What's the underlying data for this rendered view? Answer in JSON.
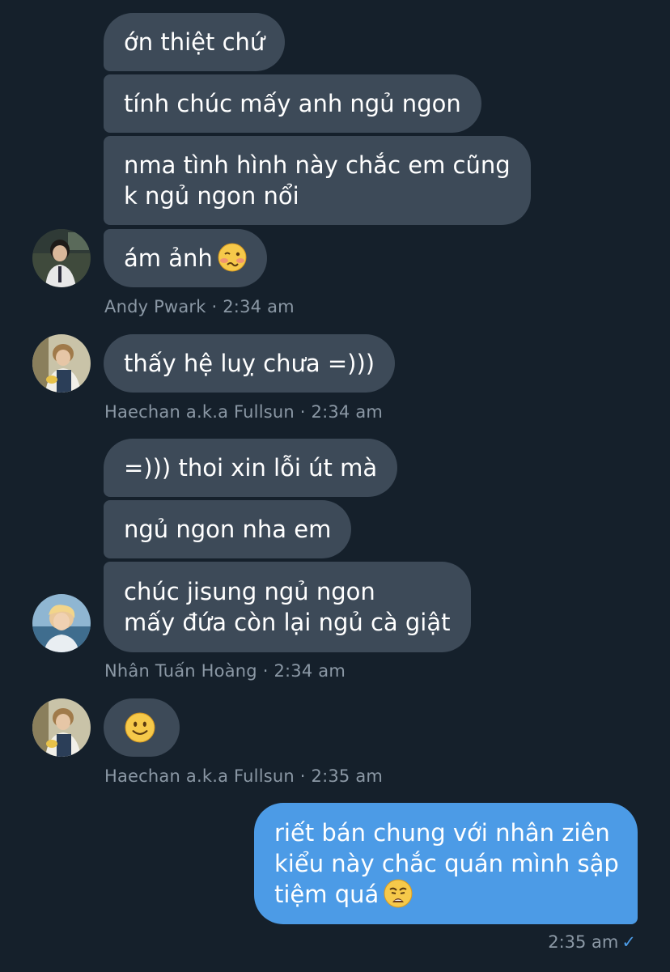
{
  "colors": {
    "background": "#15202b",
    "incoming_bubble": "#3d4a58",
    "outgoing_bubble": "#4c9be6",
    "meta_text": "#8b98a5"
  },
  "messages": [
    {
      "sender": "Andy Pwark",
      "text": [
        "ớn thiệt chứ"
      ]
    },
    {
      "sender": "Andy Pwark",
      "text": [
        "tính chúc mấy anh ngủ ngon"
      ]
    },
    {
      "sender": "Andy Pwark",
      "text": [
        "nma tình hình này chắc em cũng",
        "k ngủ ngon nổi"
      ]
    },
    {
      "sender": "Andy Pwark",
      "text": [
        "ám ảnh"
      ],
      "emoji": "woozy-face-emoji"
    },
    {
      "sender": "Haechan a.k.a Fullsun",
      "text": [
        "thấy hệ luỵ chưa =)))"
      ]
    },
    {
      "sender": "Nhân Tuấn Hoàng",
      "text": [
        "=))) thoi xin lỗi út mà"
      ]
    },
    {
      "sender": "Nhân Tuấn Hoàng",
      "text": [
        "ngủ ngon nha em"
      ]
    },
    {
      "sender": "Nhân Tuấn Hoàng",
      "text": [
        "chúc jisung ngủ ngon",
        "mấy đứa còn lại ngủ cà giật"
      ]
    },
    {
      "sender": "Haechan a.k.a Fullsun",
      "emoji": "slightly-smiling-face-emoji"
    },
    {
      "sender": "me",
      "text": [
        "riết bán chung với nhân ziên",
        "kiểu này chắc quán mình sập",
        "tiệm quá"
      ],
      "emoji": "weary-face-emoji"
    }
  ],
  "meta": {
    "andy": "Andy Pwark · 2:34 am",
    "haechan1": "Haechan a.k.a Fullsun · 2:34 am",
    "nhan": "Nhân Tuấn Hoàng · 2:34 am",
    "haechan2": "Haechan a.k.a Fullsun · 2:35 am",
    "mine_time": "2:35 am",
    "mine_status": "✓"
  }
}
